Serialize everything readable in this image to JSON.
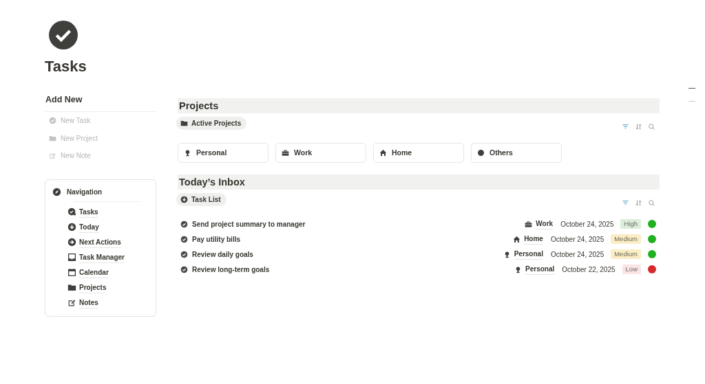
{
  "page": {
    "title": "Tasks"
  },
  "add_new": {
    "title": "Add New",
    "items": [
      {
        "label": "New Task",
        "kind": "check"
      },
      {
        "label": "New Project",
        "kind": "folder"
      },
      {
        "label": "New Note",
        "kind": "note"
      }
    ]
  },
  "navigation": {
    "title": "Navigation",
    "items": [
      {
        "label": "Tasks",
        "kind": "tasks"
      },
      {
        "label": "Today",
        "kind": "down"
      },
      {
        "label": "Next Actions",
        "kind": "arrow"
      },
      {
        "label": "Task Manager",
        "kind": "inbox"
      },
      {
        "label": "Calendar",
        "kind": "calendar"
      },
      {
        "label": "Projects",
        "kind": "folder"
      },
      {
        "label": "Notes",
        "kind": "note"
      }
    ]
  },
  "projects": {
    "title": "Projects",
    "view": {
      "label": "Active Projects",
      "kind": "folder"
    },
    "cards": [
      {
        "label": "Personal",
        "kind": "person"
      },
      {
        "label": "Work",
        "kind": "briefcase"
      },
      {
        "label": "Home",
        "kind": "home"
      },
      {
        "label": "Others",
        "kind": "circle"
      }
    ]
  },
  "inbox": {
    "title": "Today’s Inbox",
    "view": {
      "label": "Task List",
      "kind": "down"
    },
    "tasks": [
      {
        "title": "Send project summary to manager",
        "project": {
          "label": "Work",
          "kind": "briefcase"
        },
        "date": "October 24, 2025",
        "priority": {
          "label": "High",
          "color": "#dbeddb"
        },
        "color": "#22b022"
      },
      {
        "title": "Pay utility bills",
        "project": {
          "label": "Home",
          "kind": "home"
        },
        "date": "October 24, 2025",
        "priority": {
          "label": "Medium",
          "color": "#fbeec4"
        },
        "color": "#22b022"
      },
      {
        "title": "Review daily goals",
        "project": {
          "label": "Personal",
          "kind": "person"
        },
        "date": "October 24, 2025",
        "priority": {
          "label": "Medium",
          "color": "#fbeec4"
        },
        "color": "#22b022"
      },
      {
        "title": "Review long-term goals",
        "project": {
          "label": "Personal",
          "kind": "person"
        },
        "date": "October 22, 2025",
        "priority": {
          "label": "Low",
          "color": "#fbe4e4"
        },
        "color": "#d42a2a"
      }
    ]
  }
}
